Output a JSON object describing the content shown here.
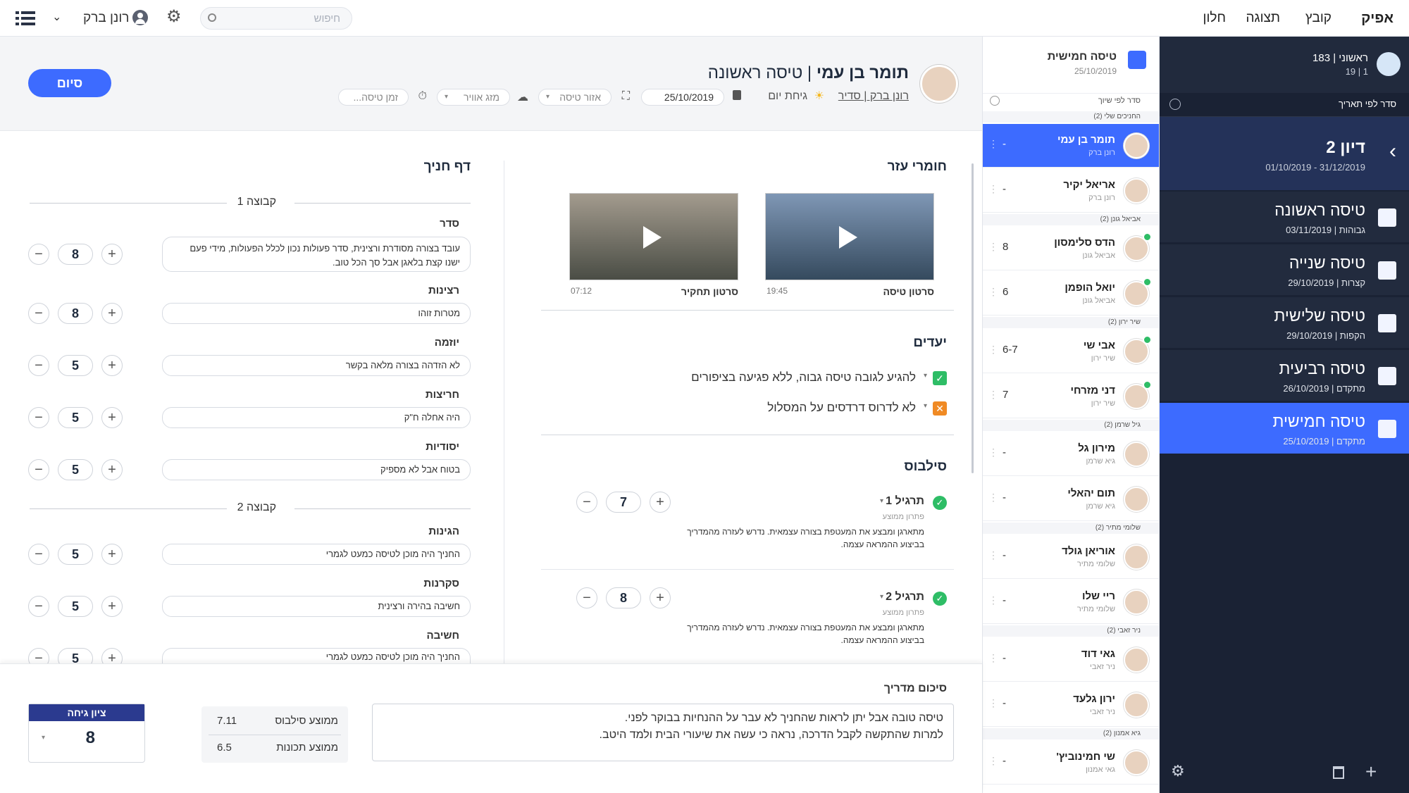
{
  "app": {
    "logo": "אפיק"
  },
  "menu": [
    "קובץ",
    "תצוגה",
    "חלון"
  ],
  "search": {
    "placeholder": "חיפוש"
  },
  "user": {
    "name": "רונן ברק"
  },
  "nav": {
    "stats": "ראשוני | 183",
    "sub": "1 | 19",
    "sort_label": "סדר לפי תאריך",
    "course": {
      "title": "דיון 2",
      "dates": "01/10/2019 - 31/12/2019"
    },
    "flights": [
      {
        "title": "טיסה ראשונה",
        "meta": "גבוהות | 03/11/2019"
      },
      {
        "title": "טיסה שנייה",
        "meta": "קצרות | 29/10/2019"
      },
      {
        "title": "טיסה שלישית",
        "meta": "הקפות | 29/10/2019"
      },
      {
        "title": "טיסה רביעית",
        "meta": "מתקדם | 26/10/2019"
      },
      {
        "title": "טיסה חמישית",
        "meta": "מתקדם | 25/10/2019"
      }
    ]
  },
  "list": {
    "title": "טיסה חמישית",
    "date": "25/10/2019",
    "sort_label": "סדר לפי שיוך",
    "groups": [
      "החניכים שלי (2)",
      "אביאל גונן (2)",
      "שיר ירון (2)",
      "גיל שרמן (2)",
      "שלומי מתיר (2)",
      "ניר זאבי (2)",
      "גיא אמנון (2)"
    ],
    "students": [
      {
        "name": "תומר בן עמי",
        "instr": "רונן ברק",
        "score": "-"
      },
      {
        "name": "אריאל יקיר",
        "instr": "רונן ברק",
        "score": "-"
      },
      {
        "name": "הדס סלימסון",
        "instr": "אביאל גונן",
        "score": "8"
      },
      {
        "name": "יואל הופמן",
        "instr": "אביאל גונן",
        "score": "6"
      },
      {
        "name": "אבי שי",
        "instr": "שיר ירון",
        "score": "6-7"
      },
      {
        "name": "דני מזרחי",
        "instr": "שיר ירון",
        "score": "7"
      },
      {
        "name": "מירון גל",
        "instr": "גיא שרמן",
        "score": "-"
      },
      {
        "name": "תום יהאלי",
        "instr": "גיא שרמן",
        "score": "-"
      },
      {
        "name": "אוריאן גולד",
        "instr": "שלומי מתיר",
        "score": "-"
      },
      {
        "name": "ריי שלו",
        "instr": "שלומי מתיר",
        "score": "-"
      },
      {
        "name": "גאי דוד",
        "instr": "ניר זאבי",
        "score": "-"
      },
      {
        "name": "ירון גלעד",
        "instr": "ניר זאבי",
        "score": "-"
      },
      {
        "name": "שי חמינוביץ'",
        "instr": "גאי אמנון",
        "score": "-"
      }
    ]
  },
  "header": {
    "student": "תומר בן עמי",
    "flight": "| טיסה ראשונה",
    "instructor_link": "רונן ברק | סדיר",
    "daytime": "גיחת יום",
    "date": "25/10/2019",
    "area": "אזור טיסה",
    "weather": "מזג אוויר",
    "time": "זמן טיסה...",
    "finish_button": "סיום"
  },
  "materials": {
    "title": "חומרי עזר",
    "videos": [
      {
        "name": "סרטון טיסה",
        "duration": "19:45"
      },
      {
        "name": "סרטון תחקיר",
        "duration": "07:12"
      }
    ]
  },
  "goals": {
    "title": "יעדים",
    "items": [
      {
        "text": "להגיע לגובה טיסה גבוה, ללא פגיעה בציפורים",
        "status": "done",
        "color": "#2ebd66"
      },
      {
        "text": "לא לדרוס דרדסים על המסלול",
        "status": "failed",
        "color": "#f08a24"
      }
    ]
  },
  "syllabus": {
    "title": "סילבוס",
    "exercises": [
      {
        "name": "תרגיל 1",
        "subtitle": "פתרון ממוצע",
        "desc": "מתארגן ומבצע את המעטפת בצורה עצמאית. נדרש לעזרה מהמדריך בביצוע ההמראה עצמה.",
        "score": "7"
      },
      {
        "name": "תרגיל 2",
        "subtitle": "פתרון ממוצע",
        "desc": "מתארגן ומבצע את המעטפת בצורה עצמאית. נדרש לעזרה מהמדריך בביצוע ההמראה עצמה.",
        "score": "8"
      }
    ]
  },
  "student_sheet": {
    "title": "דף חניך",
    "groups": [
      {
        "name": "קבוצה 1",
        "items": [
          {
            "label": "סדר",
            "text": "עובד בצורה מסודרת ורצינית, סדר פעולות נכון לכלל הפעולות, מידי פעם ישנו קצת בלאגן אבל סך הכל טוב.",
            "score": "8"
          },
          {
            "label": "רצינות",
            "text": "מטרות זוהו",
            "score": "8"
          },
          {
            "label": "יוזמה",
            "text": "לא הזדהה בצורה מלאה בקשר",
            "score": "5"
          },
          {
            "label": "חריצות",
            "text": "היה אחלה ח\"ק",
            "score": "5"
          },
          {
            "label": "יסודיות",
            "text": "בטוח אבל לא מספיק",
            "score": "5"
          }
        ]
      },
      {
        "name": "קבוצה 2",
        "items": [
          {
            "label": "הגינות",
            "text": "החניך היה מוכן לטיסה כמעט לגמרי",
            "score": "5"
          },
          {
            "label": "סקרנות",
            "text": "חשיבה בהירה ורצינית",
            "score": "5"
          },
          {
            "label": "חשיבה",
            "text": "החניך היה מוכן לטיסה כמעט לגמרי",
            "score": "5"
          }
        ]
      }
    ]
  },
  "summary": {
    "title": "סיכום מדריך",
    "line1": "טיסה טובה אבל יתן לראות שהחניך לא עבר על ההנחיות בבוקר לפני.",
    "line2": "למרות שהתקשה לקבל הדרכה, נראה כי עשה את שיעורי הבית ולמד היטב.",
    "syllabus_avg_label": "ממוצע סילבוס",
    "syllabus_avg": "7.11",
    "traits_avg_label": "ממוצע תכונות",
    "traits_avg": "6.5",
    "grade_label": "ציון גיחה",
    "grade": "8"
  },
  "colors": {
    "accent": "#3d6bff",
    "nav_bg": "#1a2234",
    "grade_header": "#2b3a8f"
  }
}
